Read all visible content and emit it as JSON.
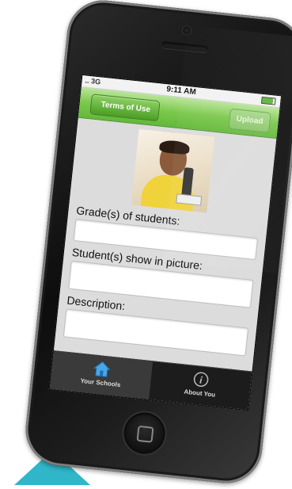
{
  "status": {
    "signal_text": "3G",
    "time": "9:11 AM"
  },
  "navbar": {
    "back_label": "Terms of Use",
    "upload_label": "Upload"
  },
  "form": {
    "grade_label": "Grade(s) of students:",
    "grade_value": "",
    "students_label": "Student(s) show in picture:",
    "students_value": "",
    "description_label": "Description:",
    "description_value": ""
  },
  "tabbar": {
    "items": [
      {
        "label": "Your Schools",
        "icon": "house-icon"
      },
      {
        "label": "About You",
        "icon": "info-icon"
      }
    ]
  },
  "colors": {
    "navbar_green": "#7bc84c",
    "accent_cyan": "#2fb6c9"
  }
}
